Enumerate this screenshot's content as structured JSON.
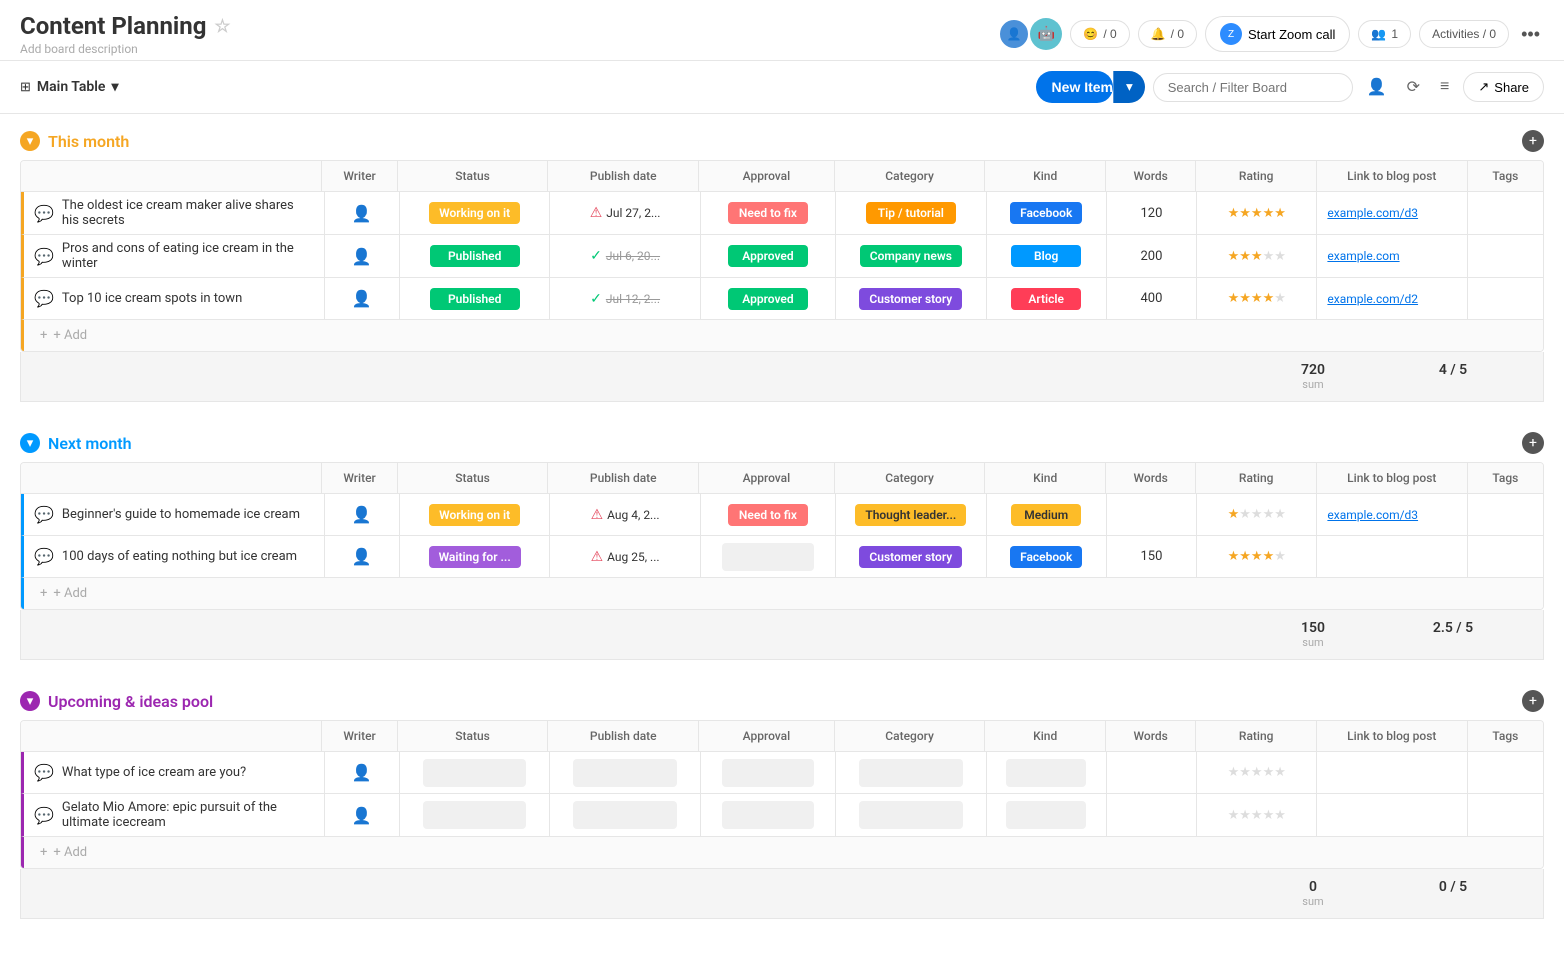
{
  "header": {
    "title": "Content Planning",
    "star": "☆",
    "desc": "Add board description",
    "zoom_label": "Start Zoom call",
    "activities_label": "Activities / 0",
    "members_label": "1",
    "reactions_count": "0",
    "updates_count": "0"
  },
  "toolbar": {
    "table_name": "Main Table",
    "new_item_label": "New Item",
    "search_placeholder": "Search / Filter Board",
    "share_label": "Share"
  },
  "groups": [
    {
      "id": "this-month",
      "title": "This month",
      "color": "#f5a623",
      "columns": [
        "Writer",
        "Status",
        "Publish date",
        "Approval",
        "Category",
        "Kind",
        "Words",
        "Rating",
        "Link to blog post",
        "Tags"
      ],
      "rows": [
        {
          "name": "The oldest ice cream maker alive shares his secrets",
          "status": "Working on it",
          "status_class": "status-working",
          "date": "Jul 27, 2...",
          "date_icon": "red",
          "approval": "Need to fix",
          "approval_class": "approval-fix",
          "category": "Tip / tutorial",
          "category_class": "cat-tip",
          "kind": "Facebook",
          "kind_class": "kind-facebook",
          "words": "120",
          "rating": 5,
          "link": "example.com/d3"
        },
        {
          "name": "Pros and cons of eating ice cream in the winter",
          "status": "Published",
          "status_class": "status-published",
          "date": "Jul 6, 20...",
          "date_icon": "green",
          "date_strikethrough": true,
          "approval": "Approved",
          "approval_class": "approval-approved",
          "category": "Company news",
          "category_class": "cat-company",
          "kind": "Blog",
          "kind_class": "kind-blog",
          "words": "200",
          "rating": 3,
          "link": "example.com"
        },
        {
          "name": "Top 10 ice cream spots in town",
          "status": "Published",
          "status_class": "status-published",
          "date": "Jul 12, 2...",
          "date_icon": "green",
          "date_strikethrough": true,
          "approval": "Approved",
          "approval_class": "approval-approved",
          "category": "Customer story",
          "category_class": "cat-customer",
          "kind": "Article",
          "kind_class": "kind-article",
          "words": "400",
          "rating": 4,
          "link": "example.com/d2"
        }
      ],
      "sum_words": "720",
      "sum_rating": "4 / 5"
    },
    {
      "id": "next-month",
      "title": "Next month",
      "color": "#0099ff",
      "columns": [
        "Writer",
        "Status",
        "Publish date",
        "Approval",
        "Category",
        "Kind",
        "Words",
        "Rating",
        "Link to blog post",
        "Tags"
      ],
      "rows": [
        {
          "name": "Beginner's guide to homemade ice cream",
          "status": "Working on it",
          "status_class": "status-working",
          "date": "Aug 4, 2...",
          "date_icon": "red",
          "approval": "Need to fix",
          "approval_class": "approval-fix",
          "category": "Thought leader...",
          "category_class": "cat-thought",
          "kind": "Medium",
          "kind_class": "kind-medium",
          "words": "",
          "rating": 1,
          "link": "example.com/d3"
        },
        {
          "name": "100 days of eating nothing but ice cream",
          "status": "Waiting for ...",
          "status_class": "status-waiting",
          "date": "Aug 25, ...",
          "date_icon": "red",
          "approval": "",
          "approval_class": "",
          "category": "Customer story",
          "category_class": "cat-customer",
          "kind": "Facebook",
          "kind_class": "kind-facebook",
          "words": "150",
          "rating": 4,
          "link": ""
        }
      ],
      "sum_words": "150",
      "sum_rating": "2.5 / 5"
    },
    {
      "id": "upcoming",
      "title": "Upcoming & ideas pool",
      "color": "#9c27b0",
      "columns": [
        "Writer",
        "Status",
        "Publish date",
        "Approval",
        "Category",
        "Kind",
        "Words",
        "Rating",
        "Link to blog post",
        "Tags"
      ],
      "rows": [
        {
          "name": "What type of ice cream are you?",
          "status": "",
          "status_class": "",
          "date": "",
          "date_icon": "",
          "approval": "",
          "approval_class": "",
          "category": "",
          "category_class": "",
          "kind": "",
          "kind_class": "",
          "words": "",
          "rating": 0,
          "link": ""
        },
        {
          "name": "Gelato Mio Amore: epic pursuit of the ultimate icecream",
          "status": "",
          "status_class": "",
          "date": "",
          "date_icon": "",
          "approval": "",
          "approval_class": "",
          "category": "",
          "category_class": "",
          "kind": "",
          "kind_class": "",
          "words": "",
          "rating": 0,
          "link": ""
        }
      ],
      "sum_words": "0",
      "sum_rating": "0 / 5"
    }
  ]
}
